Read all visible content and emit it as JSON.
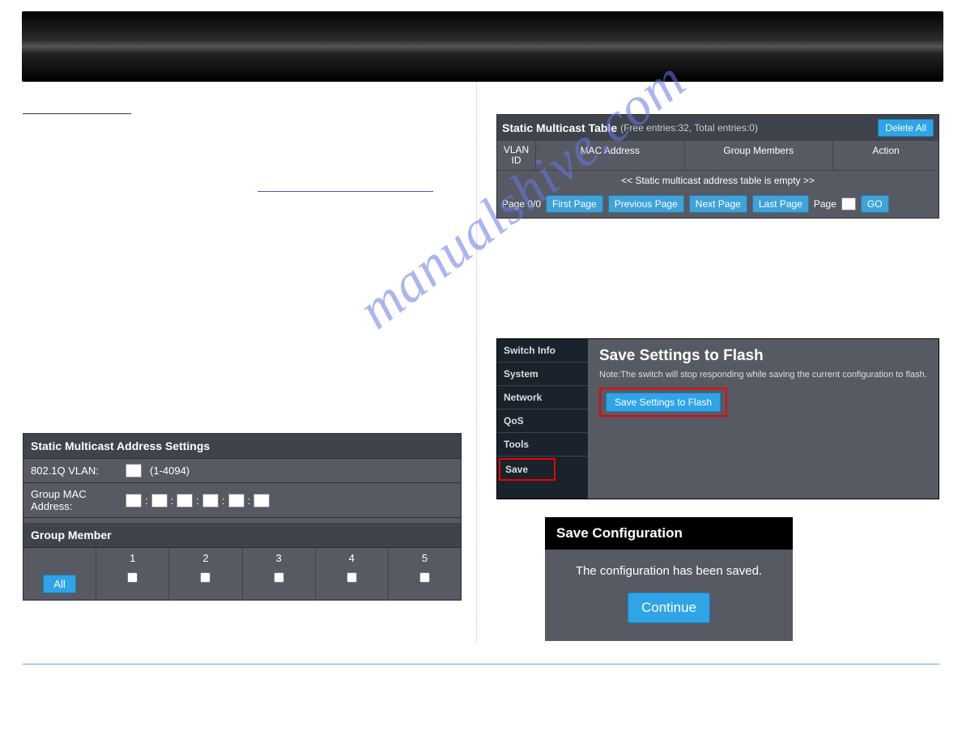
{
  "watermark": "manualshive.com",
  "panel1": {
    "title": "Static Multicast Address Settings",
    "vlan_label": "802.1Q VLAN:",
    "vlan_range": "(1-4094)",
    "mac_label": "Group MAC Address:",
    "group_member_title": "Group Member",
    "ports": [
      "1",
      "2",
      "3",
      "4",
      "5"
    ],
    "all_label": "All"
  },
  "smt": {
    "title": "Static Multicast Table",
    "stats": "(Free entries:32, Total entries:0)",
    "delete_all": "Delete All",
    "cols": {
      "vlan": "VLAN ID",
      "mac": "MAC Address",
      "grp": "Group Members",
      "act": "Action"
    },
    "empty": "<< Static multicast address table is empty >>",
    "page_label": "Page 0/0",
    "first": "First Page",
    "prev": "Previous Page",
    "next": "Next Page",
    "last": "Last Page",
    "page_word": "Page",
    "go": "GO"
  },
  "flash": {
    "nav": [
      "Switch Info",
      "System",
      "Network",
      "QoS",
      "Tools",
      "Save"
    ],
    "title": "Save Settings to Flash",
    "note": "Note:The switch will stop responding while saving the current configuration to flash.",
    "button": "Save Settings to Flash"
  },
  "saveconf": {
    "title": "Save Configuration",
    "msg": "The configuration has been saved.",
    "continue": "Continue"
  }
}
